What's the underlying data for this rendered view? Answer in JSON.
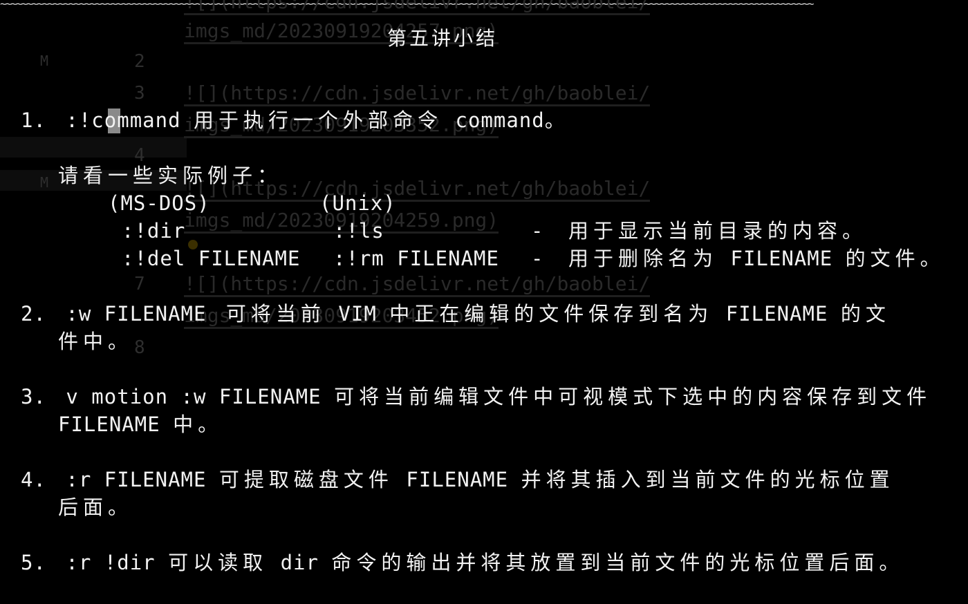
{
  "squiggle": "~~~~~~~~~~~~~~~~~~~~~~~~~~~~~~~~~~~~~~~~~~~~~~~~~~~~~~~~~~~~~~~~~~~~~~~~~~~~~~~~~~~~~~~~~~~~~~~~~~~~~~~~~~~~~~~~~~~~~~~~~~~~~~~~~~~~~~~~~~~~~~~~~~~~~~~~~~",
  "title": "第五讲小结",
  "ghost": {
    "link1": "![](https://cdn.jsdelivr.net/gh/baoblei/",
    "path1": "imgs_md/20230919204257.png)",
    "path2": "imgs_md/20230919203352.png)",
    "path3": "imgs_md/20230919204259.png)",
    "path4": "imgs_md/20230919203452.png)",
    "n2": "2",
    "n3": "3",
    "n4": "4",
    "n7": "7",
    "n8": "8",
    "m": "M"
  },
  "items": {
    "i1_num": "1.",
    "i1_cmd_pre": ":!co",
    "i1_cmd_post": "mmand",
    "i1_text": "用于执行一个外部命令",
    "i1_tail": "command。",
    "examples_label": "请看一些实际例子：",
    "col_dos": "(MS-DOS)",
    "col_unix": "(Unix)",
    "ex1_dos": ":!dir",
    "ex1_unix": ":!ls",
    "ex1_dash": "-",
    "ex1_desc": "用于显示当前目录的内容。",
    "ex2_dos": ":!del FILENAME",
    "ex2_unix": ":!rm FILENAME",
    "ex2_dash": "-",
    "ex2_desc_a": "用于删除名为",
    "ex2_desc_b": "FILENAME",
    "ex2_desc_c": "的文件。",
    "i2_num": "2.",
    "i2_a": ":w FILENAME",
    "i2_b": "可将当前",
    "i2_c": "VIM",
    "i2_d": "中正在编辑的文件保存到名为",
    "i2_e": "FILENAME",
    "i2_f": "的文",
    "i2_g": "件中。",
    "i3_num": "3.",
    "i3_a": "v motion :w FILENAME",
    "i3_b": "可将当前编辑文件中可视模式下选中的内容保存到文件",
    "i3_c": "FILENAME",
    "i3_d": "中。",
    "i4_num": "4.",
    "i4_a": ":r FILENAME",
    "i4_b": "可提取磁盘文件",
    "i4_c": "FILENAME",
    "i4_d": "并将其插入到当前文件的光标位置",
    "i4_e": "后面。",
    "i5_num": "5.",
    "i5_a": ":r !dir",
    "i5_b": "可以读取",
    "i5_c": "dir",
    "i5_d": "命令的输出并将其放置到当前文件的光标位置后面。"
  }
}
